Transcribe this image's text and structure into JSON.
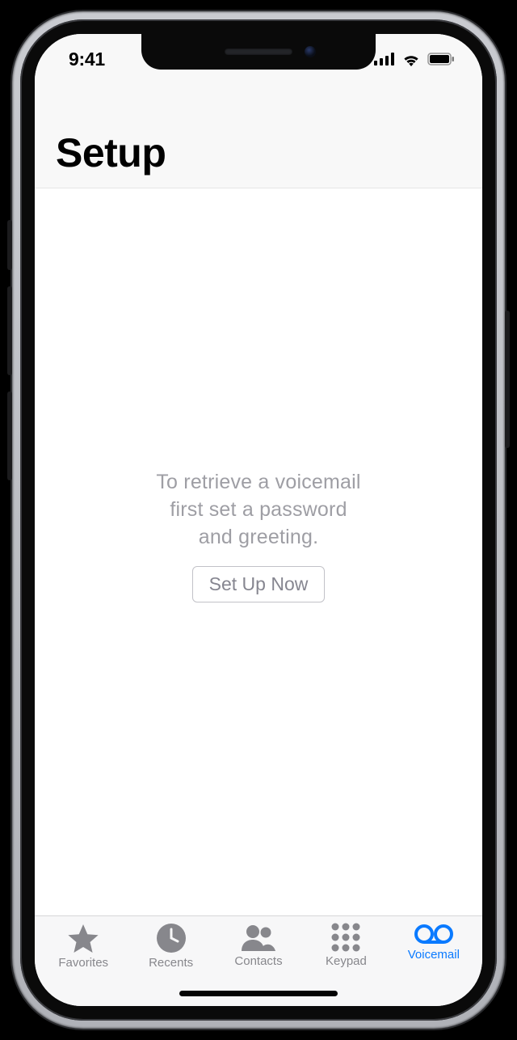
{
  "status": {
    "time": "9:41"
  },
  "header": {
    "title": "Setup"
  },
  "content": {
    "prompt_line1": "To retrieve a voicemail",
    "prompt_line2": "first set a password",
    "prompt_line3": "and greeting.",
    "setup_button": "Set Up Now"
  },
  "tabs": {
    "favorites": "Favorites",
    "recents": "Recents",
    "contacts": "Contacts",
    "keypad": "Keypad",
    "voicemail": "Voicemail"
  }
}
